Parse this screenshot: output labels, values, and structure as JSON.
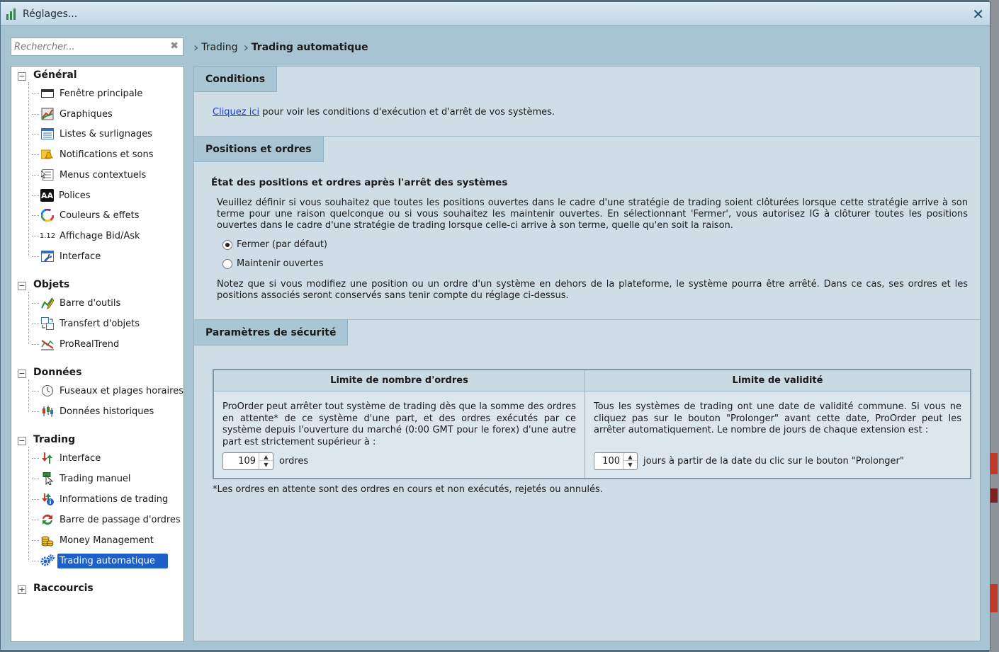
{
  "window": {
    "title": "Réglages..."
  },
  "search": {
    "placeholder": "Rechercher..."
  },
  "breadcrumb": [
    "Trading",
    "Trading automatique"
  ],
  "sidebar": {
    "groups": [
      {
        "label": "Général",
        "expanded": true,
        "items": [
          {
            "label": "Fenêtre principale",
            "icon": "window-icon"
          },
          {
            "label": "Graphiques",
            "icon": "chart-icon"
          },
          {
            "label": "Listes & surlignages",
            "icon": "list-icon"
          },
          {
            "label": "Notifications et sons",
            "icon": "bell-icon"
          },
          {
            "label": "Menus contextuels",
            "icon": "menu-icon"
          },
          {
            "label": "Polices",
            "icon": "font-icon",
            "glyph": "AA"
          },
          {
            "label": "Couleurs & effets",
            "icon": "color-wheel-icon"
          },
          {
            "label": "Affichage Bid/Ask",
            "icon": "decimal-icon",
            "glyph": "1.12"
          },
          {
            "label": "Interface",
            "icon": "wrench-icon"
          }
        ]
      },
      {
        "label": "Objets",
        "expanded": true,
        "items": [
          {
            "label": "Barre d'outils",
            "icon": "pencil-icon"
          },
          {
            "label": "Transfert d'objets",
            "icon": "transfer-icon"
          },
          {
            "label": "ProRealTrend",
            "icon": "trend-icon"
          }
        ]
      },
      {
        "label": "Données",
        "expanded": true,
        "items": [
          {
            "label": "Fuseaux et plages horaires",
            "icon": "clock-icon"
          },
          {
            "label": "Données historiques",
            "icon": "history-icon"
          }
        ]
      },
      {
        "label": "Trading",
        "expanded": true,
        "items": [
          {
            "label": "Interface",
            "icon": "trading-interface-icon"
          },
          {
            "label": "Trading manuel",
            "icon": "cursor-icon"
          },
          {
            "label": "Informations de trading",
            "icon": "info-icon"
          },
          {
            "label": "Barre de passage d'ordres",
            "icon": "order-bar-icon"
          },
          {
            "label": "Money Management",
            "icon": "coins-icon"
          },
          {
            "label": "Trading automatique",
            "icon": "gears-icon",
            "selected": true
          }
        ]
      },
      {
        "label": "Raccourcis",
        "expanded": false,
        "items": []
      }
    ]
  },
  "conditions": {
    "tab": "Conditions",
    "link": "Cliquez ici",
    "text": " pour voir les conditions d'exécution et d'arrêt de vos systèmes."
  },
  "positions": {
    "tab": "Positions et ordres",
    "heading": "État des positions et ordres après l'arrêt des systèmes",
    "paragraph": "Veuillez définir si vous souhaitez que toutes les positions ouvertes dans le cadre d'une stratégie de trading soient clôturées lorsque cette stratégie arrive à son terme pour une raison quelconque ou si vous souhaitez les maintenir ouvertes. En sélectionnant 'Fermer', vous autorisez IG à clôturer toutes les positions ouvertes dans le cadre d'une stratégie de trading lorsque celle-ci arrive à son terme, quelle qu'en soit la raison.",
    "options": [
      {
        "label": "Fermer (par défaut)",
        "selected": true
      },
      {
        "label": "Maintenir ouvertes",
        "selected": false
      }
    ],
    "note": "Notez que si vous modifiez une position ou un ordre d'un système en dehors de la plateforme, le système pourra être arrêté. Dans ce cas, ses ordres et les positions associés seront conservés sans tenir compte du réglage ci-dessus."
  },
  "security": {
    "tab": "Paramètres de sécurité",
    "order_limit": {
      "header": "Limite de nombre d'ordres",
      "text": "ProOrder peut arrêter tout système de trading dès que la somme des ordres en attente* de ce système d'une part, et des ordres exécutés par ce système depuis l'ouverture du marché (0:00 GMT pour le forex) d'une autre part est strictement supérieur à :",
      "value": "109",
      "unit": "ordres"
    },
    "validity": {
      "header": "Limite de validité",
      "text": "Tous les systèmes de trading ont une date de validité commune. Si vous ne cliquez pas sur le bouton \"Prolonger\" avant cette date, ProOrder peut les arrêter automatiquement. Le nombre de jours de chaque extension est :",
      "value": "100",
      "unit": "jours à partir de la date du clic sur le bouton \"Prolonger\""
    },
    "footnote": "*Les ordres en attente sont des ordres en cours et non exécutés, rejetés ou annulés."
  },
  "colors": {
    "selection": "#1f60c8",
    "link": "#1c3fd1",
    "panel": "#cfdee6",
    "tab": "#aac5d4"
  }
}
